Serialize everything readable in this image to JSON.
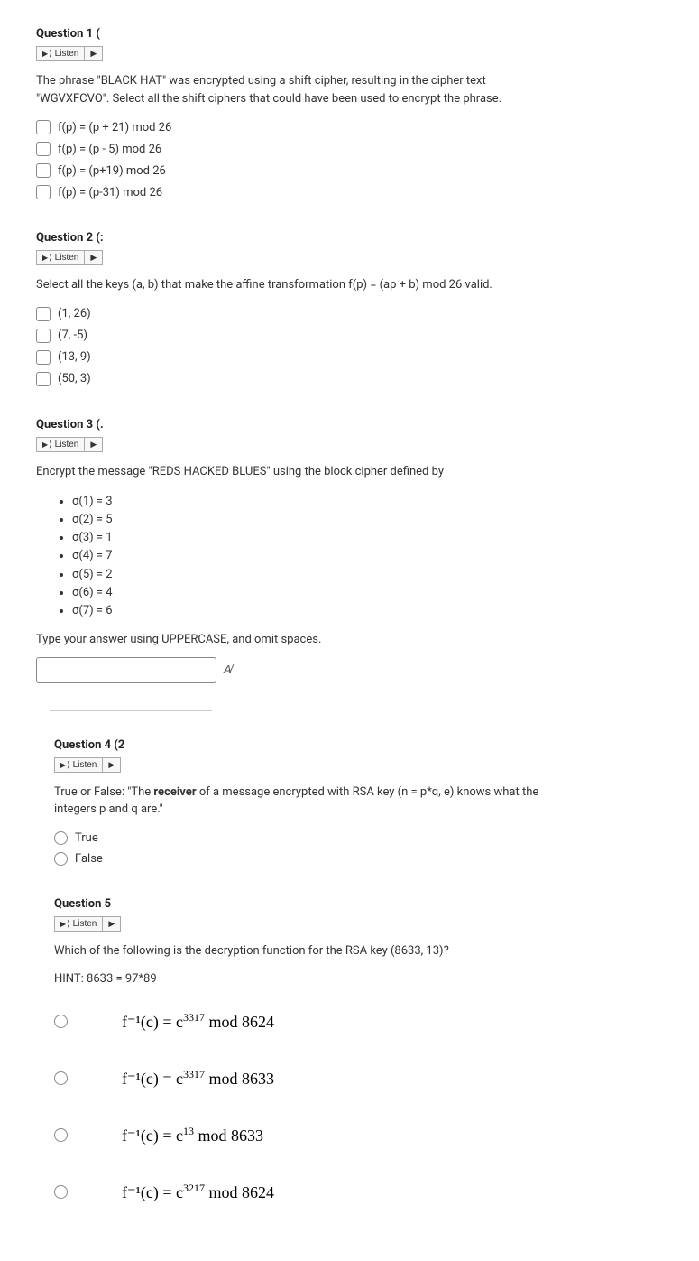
{
  "listen_label": "Listen",
  "q1": {
    "title": "Question 1 (",
    "body": "The phrase \"BLACK HAT\" was encrypted using a shift cipher, resulting in the cipher text \"WGVXFCVO\". Select all the shift ciphers that could have been used to encrypt the phrase.",
    "opts": [
      "f(p) = (p + 21) mod 26",
      "f(p) = (p - 5) mod 26",
      "f(p) = (p+19) mod 26",
      "f(p) = (p-31) mod 26"
    ]
  },
  "q2": {
    "title": "Question 2 (:",
    "body": "Select all the keys (a, b) that make the affine transformation f(p) = (ap + b) mod 26 valid.",
    "opts": [
      "(1, 26)",
      "(7, -5)",
      "(13, 9)",
      "(50, 3)"
    ]
  },
  "q3": {
    "title": "Question 3 (.",
    "body": "Encrypt the message \"REDS HACKED BLUES\" using the block cipher defined by",
    "sigma": [
      "σ(1) = 3",
      "σ(2) = 5",
      "σ(3) = 1",
      "σ(4) = 7",
      "σ(5) = 2",
      "σ(6) = 4",
      "σ(7) = 6"
    ],
    "instr": "Type your answer using UPPERCASE, and omit spaces."
  },
  "q4": {
    "title": "Question 4 (2",
    "body_pre": "True or False: \"The ",
    "body_bold": "receiver",
    "body_post": " of a message encrypted with RSA key (n = p*q, e) knows what the integers p and q are.\"",
    "opts": [
      "True",
      "False"
    ]
  },
  "q5": {
    "title": "Question 5",
    "body": "Which of the following is the decryption function for the RSA key (8633, 13)?",
    "hint": "HINT: 8633 = 97*89",
    "formulas": [
      {
        "base": "f⁻¹(c) = c",
        "exp": "3317",
        "mod": "   mod  8624"
      },
      {
        "base": "f⁻¹(c) = c",
        "exp": "3317",
        "mod": "   mod  8633"
      },
      {
        "base": "f⁻¹(c) = c",
        "exp": "13",
        "mod": "   mod  8633"
      },
      {
        "base": "f⁻¹(c) = c",
        "exp": "3217",
        "mod": "   mod  8624"
      }
    ]
  }
}
